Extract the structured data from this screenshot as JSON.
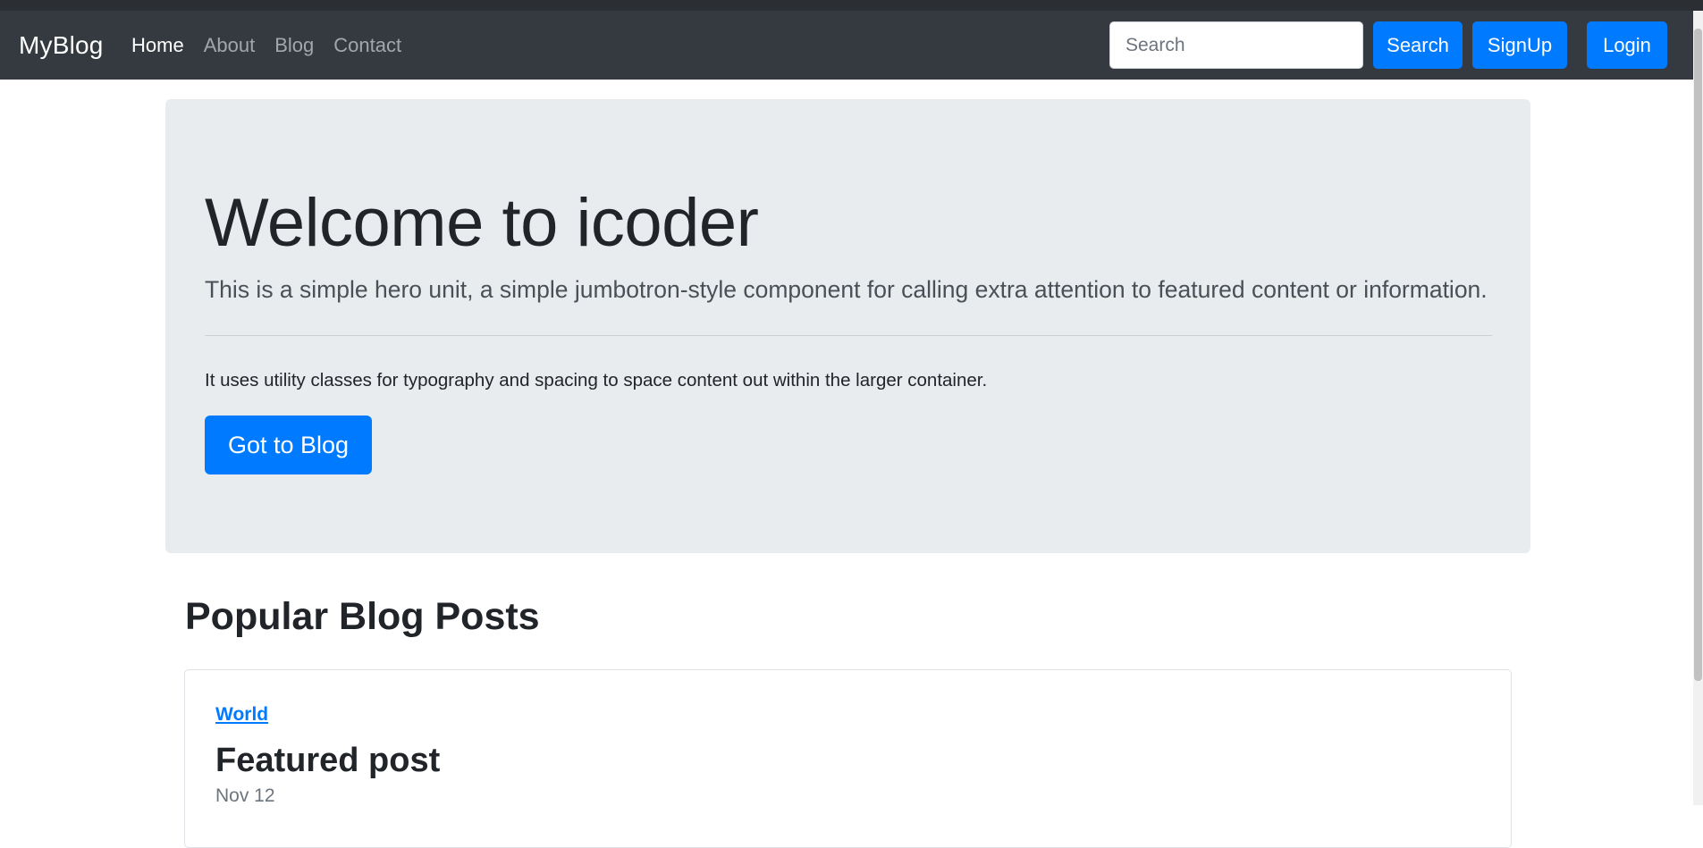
{
  "navbar": {
    "brand": "MyBlog",
    "links": [
      {
        "label": "Home",
        "active": true
      },
      {
        "label": "About",
        "active": false
      },
      {
        "label": "Blog",
        "active": false
      },
      {
        "label": "Contact",
        "active": false
      }
    ],
    "search": {
      "placeholder": "Search",
      "value": ""
    },
    "search_button": "Search",
    "signup_button": "SignUp",
    "login_button": "Login"
  },
  "hero": {
    "title": "Welcome to icoder",
    "lead": "This is a simple hero unit, a simple jumbotron-style component for calling extra attention to featured content or information.",
    "text": "It uses utility classes for typography and spacing to space content out within the larger container.",
    "button": "Got to Blog"
  },
  "posts": {
    "section_title": "Popular Blog Posts",
    "items": [
      {
        "category": "World",
        "title": "Featured post",
        "date": "Nov 12"
      }
    ]
  },
  "colors": {
    "navbar_bg": "#343a40",
    "primary": "#007bff",
    "jumbotron_bg": "#e9ecef"
  }
}
